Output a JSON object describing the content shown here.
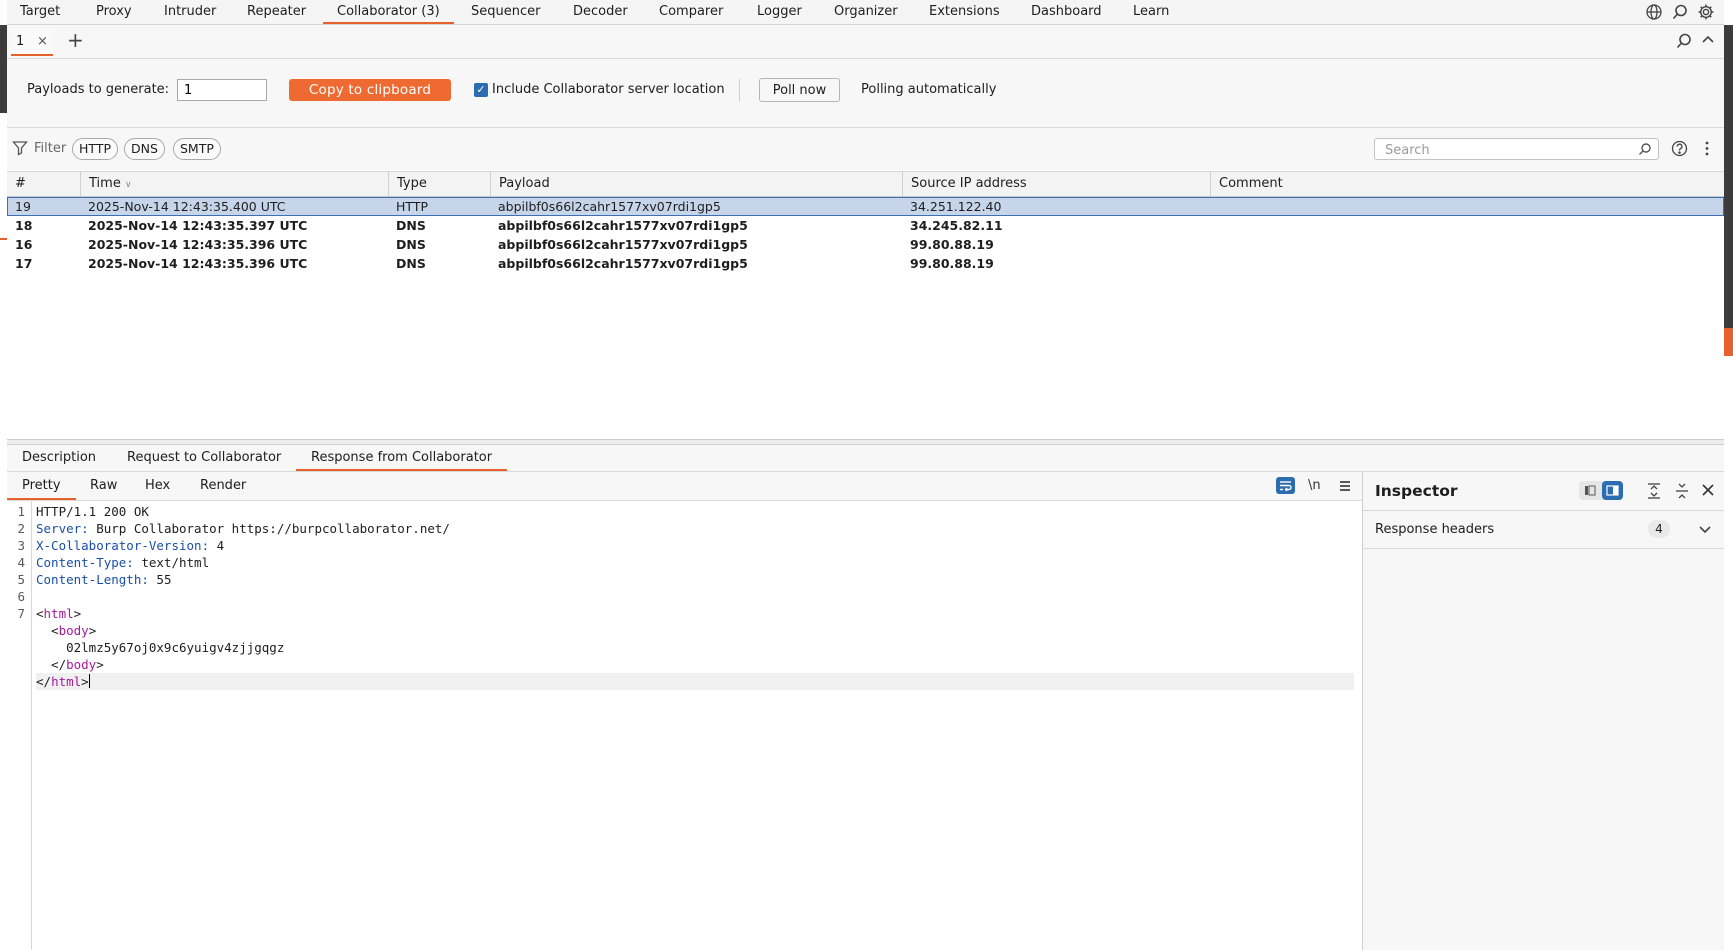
{
  "top_tabs": [
    {
      "label": "Target"
    },
    {
      "label": "Proxy"
    },
    {
      "label": "Intruder"
    },
    {
      "label": "Repeater"
    },
    {
      "label": "Collaborator (3)"
    },
    {
      "label": "Sequencer"
    },
    {
      "label": "Decoder"
    },
    {
      "label": "Comparer"
    },
    {
      "label": "Logger"
    },
    {
      "label": "Organizer"
    },
    {
      "label": "Extensions"
    },
    {
      "label": "Dashboard"
    },
    {
      "label": "Learn"
    }
  ],
  "active_top_tab": "Collaborator (3)",
  "sub_tabs": [
    {
      "label": "1",
      "close": "×"
    }
  ],
  "add_tab_symbol": "+",
  "controls": {
    "payloads_label": "Payloads to generate:",
    "payloads_value": "1",
    "copy_button": "Copy to clipboard",
    "include_label": "Include Collaborator server location",
    "include_checked": true,
    "poll_button": "Poll now",
    "polling_status": "Polling automatically"
  },
  "filter": {
    "label": "Filter",
    "chips": [
      "HTTP",
      "DNS",
      "SMTP"
    ],
    "search_placeholder": "Search"
  },
  "table": {
    "columns": [
      "#",
      "Time",
      "Type",
      "Payload",
      "Source IP address",
      "Comment"
    ],
    "rows": [
      {
        "num": "19",
        "time": "2025-Nov-14 12:43:35.400 UTC",
        "type": "HTTP",
        "payload": "abpilbf0s66l2cahr1577xv07rdi1gp5",
        "ip": "34.251.122.40",
        "comment": "",
        "selected": true,
        "bold": false
      },
      {
        "num": "18",
        "time": "2025-Nov-14 12:43:35.397 UTC",
        "type": "DNS",
        "payload": "abpilbf0s66l2cahr1577xv07rdi1gp5",
        "ip": "34.245.82.11",
        "comment": "",
        "selected": false,
        "bold": true
      },
      {
        "num": "16",
        "time": "2025-Nov-14 12:43:35.396 UTC",
        "type": "DNS",
        "payload": "abpilbf0s66l2cahr1577xv07rdi1gp5",
        "ip": "99.80.88.19",
        "comment": "",
        "selected": false,
        "bold": true
      },
      {
        "num": "17",
        "time": "2025-Nov-14 12:43:35.396 UTC",
        "type": "DNS",
        "payload": "abpilbf0s66l2cahr1577xv07rdi1gp5",
        "ip": "99.80.88.19",
        "comment": "",
        "selected": false,
        "bold": true
      }
    ]
  },
  "detail_tabs": [
    {
      "label": "Description"
    },
    {
      "label": "Request to Collaborator"
    },
    {
      "label": "Response from Collaborator"
    }
  ],
  "active_detail_tab": "Response from Collaborator",
  "editor_tabs": [
    {
      "label": "Pretty"
    },
    {
      "label": "Raw"
    },
    {
      "label": "Hex"
    },
    {
      "label": "Render"
    }
  ],
  "active_editor_tab": "Pretty",
  "newline_toggle": "\\n",
  "response_lines": [
    {
      "n": "1",
      "parts": [
        {
          "t": "HTTP/1.1 200 OK",
          "c": ""
        }
      ]
    },
    {
      "n": "2",
      "parts": [
        {
          "t": "Server:",
          "c": "hk"
        },
        {
          "t": " Burp Collaborator https://burpcollaborator.net/",
          "c": ""
        }
      ]
    },
    {
      "n": "3",
      "parts": [
        {
          "t": "X-Collaborator-Version:",
          "c": "hk"
        },
        {
          "t": " 4",
          "c": ""
        }
      ]
    },
    {
      "n": "4",
      "parts": [
        {
          "t": "Content-Type:",
          "c": "hk"
        },
        {
          "t": " text/html",
          "c": ""
        }
      ]
    },
    {
      "n": "5",
      "parts": [
        {
          "t": "Content-Length:",
          "c": "hk"
        },
        {
          "t": " 55",
          "c": ""
        }
      ]
    },
    {
      "n": "6",
      "parts": []
    },
    {
      "n": "7",
      "parts": [
        {
          "t": "<",
          "c": ""
        },
        {
          "t": "html",
          "c": "tag"
        },
        {
          "t": ">",
          "c": ""
        }
      ]
    },
    {
      "n": "",
      "parts": [
        {
          "t": "  <",
          "c": ""
        },
        {
          "t": "body",
          "c": "tag"
        },
        {
          "t": ">",
          "c": ""
        }
      ]
    },
    {
      "n": "",
      "parts": [
        {
          "t": "    02lmz5y67oj0x9c6yuigv4zjjgqgz",
          "c": ""
        }
      ]
    },
    {
      "n": "",
      "parts": [
        {
          "t": "  </",
          "c": ""
        },
        {
          "t": "body",
          "c": "tag"
        },
        {
          "t": ">",
          "c": ""
        }
      ]
    },
    {
      "n": "",
      "parts": [
        {
          "t": "</",
          "c": ""
        },
        {
          "t": "html",
          "c": "tag"
        },
        {
          "t": ">",
          "c": ""
        }
      ],
      "cursor": true
    }
  ],
  "inspector": {
    "title": "Inspector",
    "section_label": "Response headers",
    "section_count": "4"
  },
  "colors": {
    "accent": "#e8602c",
    "selected_row": "#c6d5ea",
    "header_key": "#1a4fa8",
    "html_tag": "#a31a9c",
    "checkbox": "#2c6cb0"
  }
}
